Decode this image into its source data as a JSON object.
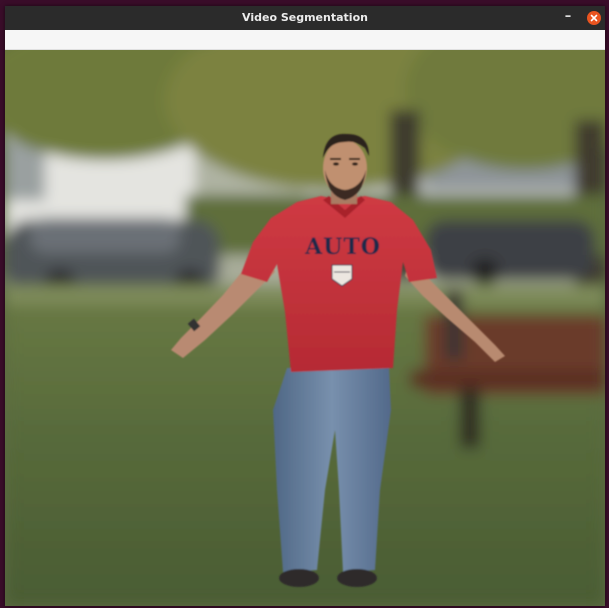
{
  "window": {
    "title": "Video Segmentation",
    "minimize_glyph": "–"
  },
  "icons": {
    "minimize": "minimize-icon",
    "close": "close-icon"
  },
  "colors": {
    "titlebar": "#2b2b2b",
    "close_button": "#e95420",
    "shirt": "#c8313a",
    "shirt_text": "#1c2a4a",
    "jeans": "#5d7593",
    "grass": "#5a6a3c"
  },
  "frame": {
    "shirt_text": "AUTO"
  }
}
